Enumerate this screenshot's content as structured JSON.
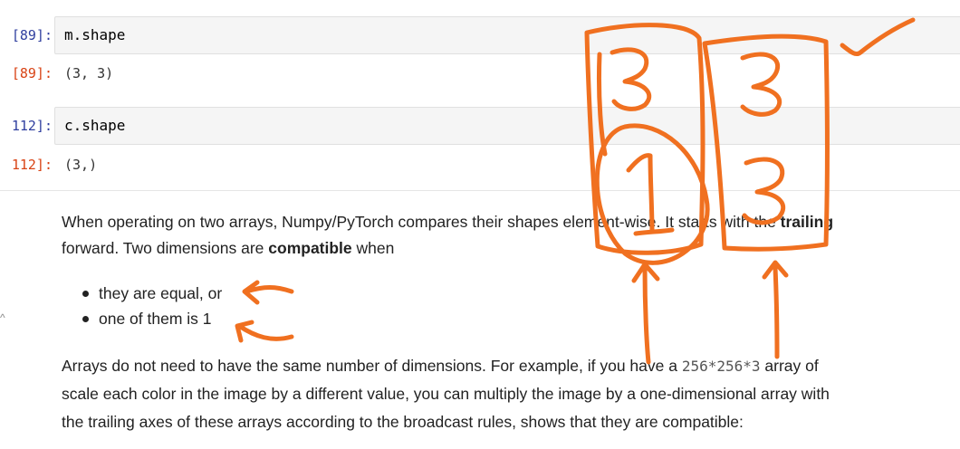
{
  "cells": [
    {
      "in_prompt": "[89]:",
      "code": "m.shape",
      "out_prompt": "[89]:",
      "output": "(3, 3)"
    },
    {
      "in_prompt": "112]:",
      "code": "c.shape",
      "out_prompt": "112]:",
      "output": "(3,)"
    }
  ],
  "markdown": {
    "p1_a": "When operating on two arrays, Numpy/PyTorch compares their shapes element-wise. It starts with the ",
    "p1_bold": "trailing",
    "p2_a": "forward. Two dimensions are ",
    "p2_bold": "compatible",
    "p2_b": " when",
    "bullets": [
      "they are equal, or",
      "one of them is 1"
    ],
    "p3_a": "Arrays do not need to have the same number of dimensions. For example, if you have a ",
    "p3_code": "256*256*3",
    "p3_b": " array of",
    "p4": "scale each color in the image by a different value, you can multiply the image by a one-dimensional array with",
    "p5": "the trailing axes of these arrays according to the broadcast rules, shows that they are compatible:"
  },
  "side_mark": "^",
  "annotations": {
    "ink_color": "#f07020",
    "left_column": [
      "3",
      "1"
    ],
    "right_column": [
      "3",
      "3"
    ]
  }
}
